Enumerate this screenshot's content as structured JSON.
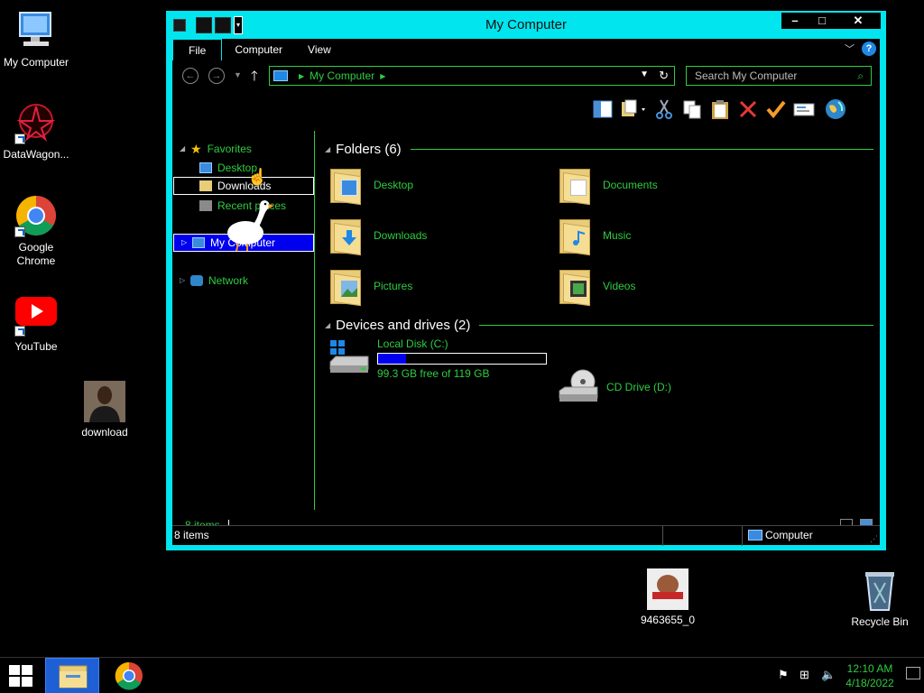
{
  "desktop": {
    "icons": [
      {
        "label": "My Computer",
        "icon": "computer-icon"
      },
      {
        "label": "DataWagon...",
        "icon": "datawagon-icon"
      },
      {
        "label": "Google Chrome",
        "icon": "chrome-icon"
      },
      {
        "label": "YouTube",
        "icon": "youtube-icon"
      },
      {
        "label": "download",
        "icon": "photo-icon"
      },
      {
        "label": "9463655_0",
        "icon": "photo-icon"
      },
      {
        "label": "Recycle Bin",
        "icon": "recycle-bin-icon"
      }
    ]
  },
  "window": {
    "title": "My Computer",
    "tabs": [
      "File",
      "Computer",
      "View"
    ],
    "address": {
      "path": "My Computer"
    },
    "search": {
      "placeholder": "Search My Computer"
    },
    "nav": {
      "favorites": "Favorites",
      "desktop": "Desktop",
      "downloads": "Downloads",
      "recent": "Recent places",
      "mycomputer": "My Computer",
      "network": "Network"
    },
    "folders_header": "Folders (6)",
    "folders": [
      "Desktop",
      "Documents",
      "Downloads",
      "Music",
      "Pictures",
      "Videos"
    ],
    "devices_header": "Devices and drives (2)",
    "drives": {
      "c_name": "Local Disk (C:)",
      "c_free": "99.3 GB free of 119 GB",
      "c_used_fraction": 0.166,
      "d_name": "CD Drive (D:)"
    },
    "status_items": "8 items",
    "footer_items": "8 items",
    "footer_location": "Computer"
  },
  "taskbar": {
    "time": "12:10 AM",
    "date": "4/18/2022"
  },
  "colors": {
    "accent": "#00e5ee",
    "text_green": "#2ecc40",
    "selection": "#0000ee"
  }
}
